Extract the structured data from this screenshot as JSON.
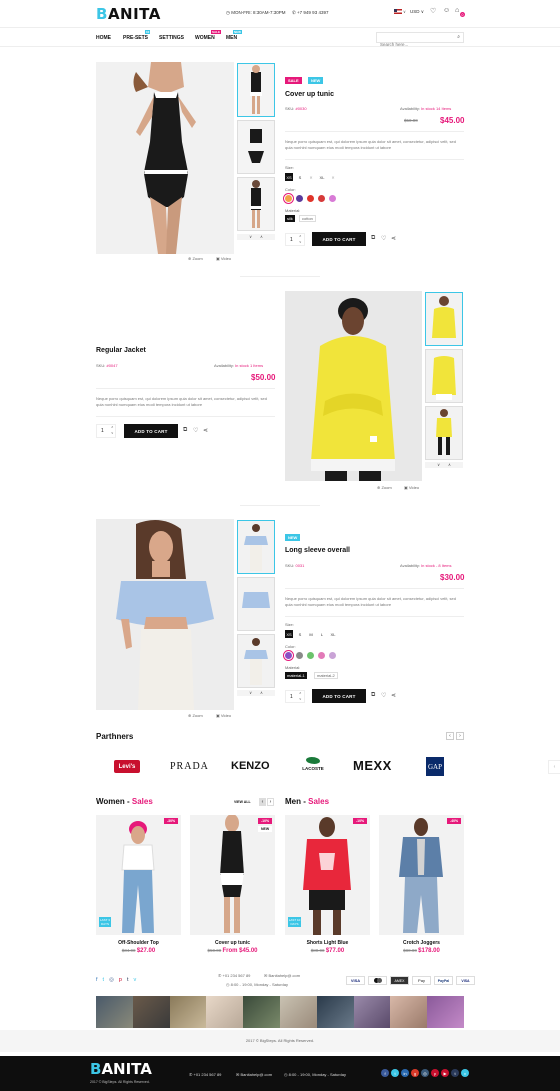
{
  "header": {
    "logo_first": "B",
    "logo_rest": "ANITA",
    "hours": "MON-FRI: 8:30AM-7:30PM",
    "phone": "+7 949 93 4397",
    "currency": "USD",
    "cart_count": "0"
  },
  "nav": {
    "items": [
      {
        "label": "HOME"
      },
      {
        "label": "PRE-SETS",
        "badge": "10"
      },
      {
        "label": "SETTINGS"
      },
      {
        "label": "WOMEN",
        "badge": "SALE"
      },
      {
        "label": "MEN",
        "badge": "NEW"
      }
    ],
    "search_placeholder": "Search here..."
  },
  "product1": {
    "badge_sale": "SALE",
    "badge_new": "NEW",
    "title": "Cover up tunic",
    "sku_label": "SKU:",
    "sku": "#0030",
    "availability_label": "Availability:",
    "availability": "In stock 14 Items",
    "old_price": "$50.00",
    "price": "$45.00",
    "description": "Neque porro quisquam est, qui dolorem ipsum quia dolor sit amet, consectetur, adipisci velit, sed quia nonhlnl numquam eius modi tempora incidunt ut labore",
    "size_label": "Size:",
    "sizes": [
      "XS",
      "S",
      "",
      "XL",
      ""
    ],
    "color_label": "Color:",
    "colors": [
      "#f1a34a",
      "#5a3a9c",
      "#e0342a",
      "#d63a3a",
      "#d87bd6"
    ],
    "material_label": "Material:",
    "material": "silk",
    "material2": "cotton",
    "qty": "1",
    "add_to_cart": "ADD TO CART",
    "zoom": "Zoom",
    "video": "Video"
  },
  "product2": {
    "title": "Regular Jacket",
    "sku_label": "SKU:",
    "sku": "#0047",
    "availability_label": "Availability:",
    "availability": "In stock 1 Items",
    "price": "$50.00",
    "description": "Neque porro quisquam est, qui dolorem ipsum quia dolor sit amet, consectetur, adipisci velit, sed quia nonhlnl numquam eius modi tempora incidunt ut labore",
    "qty": "1",
    "add_to_cart": "ADD TO CART",
    "zoom": "Zoom",
    "video": "Video"
  },
  "product3": {
    "badge_new": "NEW",
    "title": "Long sleeve overall",
    "sku_label": "SKU:",
    "sku": "0031",
    "availability_label": "Availability:",
    "availability": "In stock - 8 Items",
    "price": "$30.00",
    "description": "Neque porro quisquam est, qui dolorem ipsum quia dolor sit amet, consectetur, adipisci velit, sed quia nonhlnl numquam eius modi tempora incidunt ut labore",
    "size_label": "Size:",
    "sizes": [
      "XS",
      "S",
      "M",
      "L",
      "XL"
    ],
    "color_label": "Color:",
    "colors": [
      "#8a4fc4",
      "#8a8a8a",
      "#6cc36c",
      "#e27ab8",
      "#c9a3d6"
    ],
    "material_label": "Material:",
    "material": "material-1",
    "material2": "material-2",
    "qty": "1",
    "add_to_cart": "ADD TO CART",
    "zoom": "Zoom",
    "video": "Video"
  },
  "partners": {
    "title": "Parthners",
    "brands": [
      "Levi's",
      "PRADA",
      "KENZO",
      "LACOSTE",
      "MEXX",
      "GAP"
    ]
  },
  "women_sales": {
    "title_main": "Women",
    "title_accent": "Sales",
    "view_all": "VIEW ALL",
    "items": [
      {
        "name": "Off-Shoulder Top",
        "old": "$34.00",
        "price": "$27.00",
        "badge": "-30%",
        "timer": "LAST 3 DAYS"
      },
      {
        "name": "Cover up tunic",
        "old": "$50.00",
        "price": "From $45.00",
        "badge": "-10%",
        "badge2": "NEW"
      }
    ]
  },
  "men_sales": {
    "title_main": "Men",
    "title_accent": "Sales",
    "items": [
      {
        "name": "Shorts Light Blue",
        "old": "$80.00",
        "price": "$77.00",
        "badge": "-10%",
        "timer": "LAST 10 DAYS"
      },
      {
        "name": "Crotch Joggers",
        "old": "$80.00",
        "price": "$178.00",
        "badge": "-40%"
      }
    ]
  },
  "footer": {
    "phone": "+01 234 567 89",
    "email": "Banitahelp@.com",
    "hours": "8:00 - 19:00, Monday - Saturday",
    "payments": [
      "VISA",
      "MC",
      "AMEX",
      "Pay",
      "PayPal",
      "VISA"
    ],
    "copyright": "2017 © BigSteps. All Rights Reserved.",
    "bottom_phone": "+01 234 567 89",
    "bottom_email": "Banitahelp@.com",
    "bottom_hours": "8:00 - 19:00, Monday - Saturday",
    "bottom_copyright": "2017 © BigSteps. All Rights Reserved."
  },
  "colors": {
    "accent": "#e6197a",
    "cyan": "#3cc6e6",
    "dark": "#0e0e0e"
  }
}
